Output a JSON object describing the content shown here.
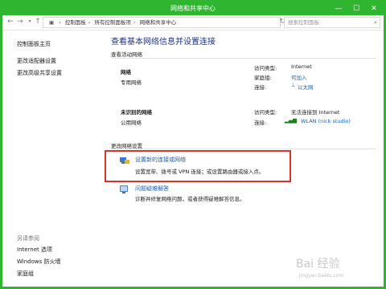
{
  "window": {
    "title": "网络和共享中心",
    "minimize": "—",
    "maximize": "☐",
    "close": "✕"
  },
  "address": {
    "crumbs": [
      "控制面板",
      "所有控制面板项",
      "网络和共享中心"
    ],
    "search_placeholder": "搜索控制面板"
  },
  "sidebar": {
    "home": "控制面板主页",
    "items": [
      "更改适配器设置",
      "更改高级共享设置"
    ],
    "see_also_title": "另请参阅",
    "see_also": [
      "Internet 选项",
      "Windows 防火墙",
      "家庭组"
    ]
  },
  "main": {
    "heading": "查看基本网络信息并设置连接",
    "active_section": "查看活动网络",
    "networks": [
      {
        "name": "网络",
        "type": "专用网络",
        "access_label": "访问类型:",
        "access_value": "Internet",
        "homegroup_label": "家庭组:",
        "homegroup_value": "可加入",
        "conn_label": "连接:",
        "conn_value": "以太网"
      },
      {
        "name": "未识别的网络",
        "type": "公用网络",
        "access_label": "访问类型:",
        "access_value": "无法连接到 Internet",
        "conn_label": "连接:",
        "conn_value": "WLAN (nick studio)"
      }
    ],
    "change_section": "更改网络设置",
    "tasks": [
      {
        "title": "设置新的连接或网络",
        "desc": "设置宽带、拨号或 VPN 连接；或设置路由器或接入点。"
      },
      {
        "title": "问题疑难解答",
        "desc": "诊断并修复网络问题，或者获得疑难解答信息。"
      }
    ]
  },
  "watermark": {
    "text": "Bai 经验",
    "sub": "jingyan.baidu.com"
  },
  "colors": {
    "frame": "#2fb52f",
    "heading": "#1e3287",
    "link": "#1a5fb4",
    "highlight": "#d9342b"
  }
}
